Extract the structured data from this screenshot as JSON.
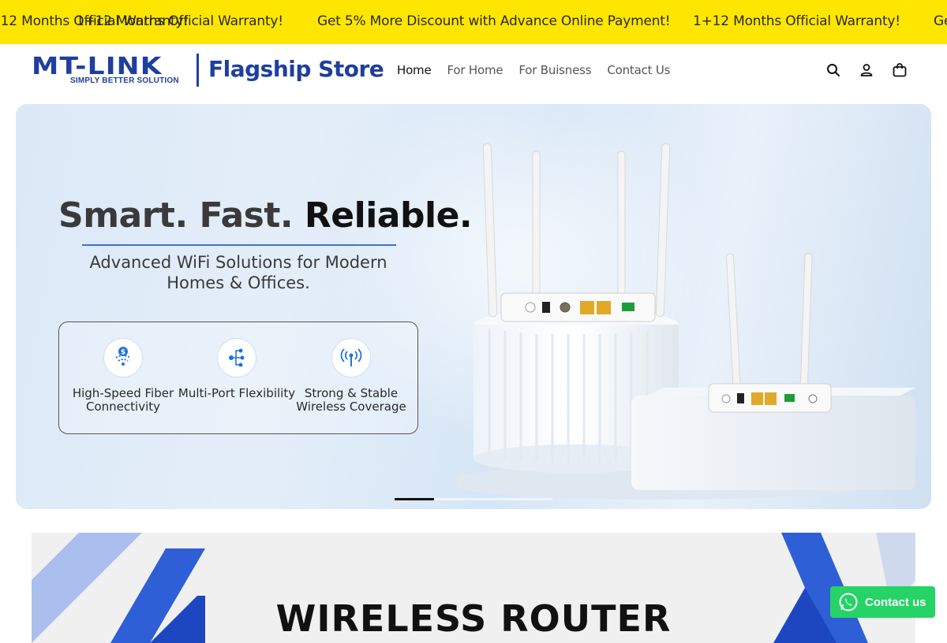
{
  "announcement": {
    "items": [
      "1+12 Months Official Warranty!",
      "Get 5% More Discount with Advance Online Payment!",
      "1+12 Months Official Warranty!",
      "Get 5% More Discount with Advance Online Payment!",
      "1+12 Months Official Warranty!"
    ]
  },
  "header": {
    "logo_text": "MT-LINK",
    "logo_tagline": "SIMPLY BETTER SOLUTION",
    "store_name": "Flagship Store",
    "nav": [
      {
        "label": "Home",
        "active": true
      },
      {
        "label": "For Home",
        "active": false
      },
      {
        "label": "For Buisness",
        "active": false
      },
      {
        "label": "Contact Us",
        "active": false
      }
    ],
    "icons": [
      "search-icon",
      "account-icon",
      "cart-icon"
    ]
  },
  "hero": {
    "title_part1": "Smart. Fast. ",
    "title_part2": "Reliable.",
    "subtitle": "Advanced WiFi Solutions for Modern Homes & Offices.",
    "features": [
      {
        "icon": "fiber-icon",
        "label": "High-Speed Fiber Connectivity"
      },
      {
        "icon": "multi-port-icon",
        "label": "Multi-Port Flexibility"
      },
      {
        "icon": "antenna-icon",
        "label": "Strong & Stable Wireless Coverage"
      }
    ],
    "slides_total": 4,
    "active_slide": 1
  },
  "banner": {
    "title": "WIRELESS ROUTER"
  },
  "contact": {
    "label": "Contact us",
    "icon": "whatsapp-icon",
    "color": "#25d366"
  },
  "colors": {
    "announcement_bg": "#ffe600",
    "brand_blue": "#1f3f9e"
  }
}
